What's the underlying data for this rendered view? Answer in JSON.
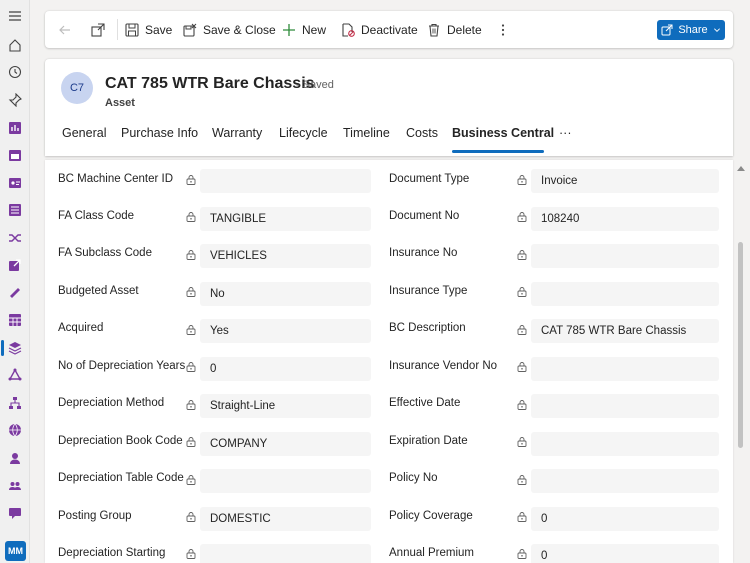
{
  "rail": {
    "icons": [
      "hamburger-icon",
      "home-icon",
      "clock-icon",
      "pin-icon",
      "bar-chart-icon",
      "calendar-icon",
      "id-card-icon",
      "list-icon",
      "shuffle-icon",
      "share-arrow-icon",
      "ruler-icon",
      "grid-calendar-icon",
      "layers-icon",
      "triangle-cycle-icon",
      "org-chart-icon",
      "globe-icon",
      "person-icon",
      "people-icon",
      "chat-icon"
    ],
    "user_initials": "MM"
  },
  "toolbar": {
    "save_label": "Save",
    "save_close_label": "Save & Close",
    "new_label": "New",
    "deactivate_label": "Deactivate",
    "delete_label": "Delete",
    "share_label": "Share"
  },
  "record": {
    "initials": "C7",
    "title": "CAT 785 WTR Bare Chassis",
    "status": "- Saved",
    "entity": "Asset"
  },
  "tabs": [
    {
      "label": "General"
    },
    {
      "label": "Purchase Info"
    },
    {
      "label": "Warranty"
    },
    {
      "label": "Lifecycle"
    },
    {
      "label": "Timeline"
    },
    {
      "label": "Costs"
    },
    {
      "label": "Business Central"
    },
    {
      "label": "···"
    }
  ],
  "fields": {
    "left": [
      {
        "label": "BC Machine Center ID",
        "value": ""
      },
      {
        "label": "FA Class Code",
        "value": "TANGIBLE"
      },
      {
        "label": "FA Subclass Code",
        "value": "VEHICLES"
      },
      {
        "label": "Budgeted Asset",
        "value": "No"
      },
      {
        "label": "Acquired",
        "value": "Yes"
      },
      {
        "label": "No of Depreciation Years",
        "value": "0"
      },
      {
        "label": "Depreciation Method",
        "value": "Straight-Line"
      },
      {
        "label": "Depreciation Book Code",
        "value": "COMPANY"
      },
      {
        "label": "Depreciation Table Code",
        "value": ""
      },
      {
        "label": "Posting Group",
        "value": "DOMESTIC"
      },
      {
        "label": "Depreciation Starting",
        "value": ""
      }
    ],
    "right": [
      {
        "label": "Document Type",
        "value": "Invoice"
      },
      {
        "label": "Document No",
        "value": "108240"
      },
      {
        "label": "Insurance No",
        "value": ""
      },
      {
        "label": "Insurance Type",
        "value": ""
      },
      {
        "label": "BC Description",
        "value": "CAT 785 WTR Bare Chassis"
      },
      {
        "label": "Insurance Vendor No",
        "value": ""
      },
      {
        "label": "Effective Date",
        "value": ""
      },
      {
        "label": "Expiration Date",
        "value": ""
      },
      {
        "label": "Policy No",
        "value": ""
      },
      {
        "label": "Policy Coverage",
        "value": "0"
      },
      {
        "label": "Annual Premium",
        "value": "0"
      }
    ]
  },
  "colors": {
    "accent": "#0f6cbd",
    "field_bg": "#f5f5f5"
  }
}
